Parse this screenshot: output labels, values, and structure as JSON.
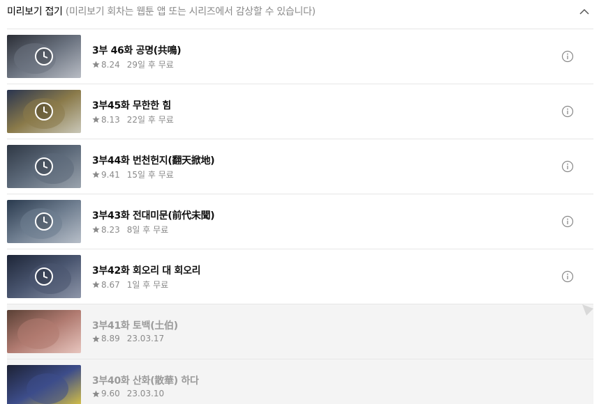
{
  "header": {
    "title": "미리보기 접기",
    "subtitle": "(미리보기 회차는 웹툰 앱 또는 시리즈에서 감상할 수 있습니다)",
    "collapse_icon": "chevron-up-icon"
  },
  "episodes": [
    {
      "title": "3부 46화 공명(共鳴)",
      "rating": "8.24",
      "status": "29일 후 무료",
      "preview": true,
      "thumb_palette": [
        "#2b2e36",
        "#6b7380",
        "#b8bcc4"
      ]
    },
    {
      "title": "3부45화 무한한 힘",
      "rating": "8.13",
      "status": "22일 후 무료",
      "preview": true,
      "thumb_palette": [
        "#2a3550",
        "#8a7a4a",
        "#c9c7b8"
      ]
    },
    {
      "title": "3부44화 번천헌지(翻天掀地)",
      "rating": "9.41",
      "status": "15일 후 무료",
      "preview": true,
      "thumb_palette": [
        "#2f3845",
        "#5d6a7a",
        "#9aa3ad"
      ]
    },
    {
      "title": "3부43화 전대미문(前代未聞)",
      "rating": "8.23",
      "status": "8일 후 무료",
      "preview": true,
      "thumb_palette": [
        "#2a3a4e",
        "#6e7d8f",
        "#b7bec8"
      ]
    },
    {
      "title": "3부42화 회오리 대 회오리",
      "rating": "8.67",
      "status": "1일 후 무료",
      "preview": true,
      "thumb_palette": [
        "#1e2638",
        "#4a5670",
        "#8d95a8"
      ]
    },
    {
      "title": "3부41화 토백(土伯)",
      "rating": "8.89",
      "status": "23.03.17",
      "preview": false,
      "thumb_palette": [
        "#5a4035",
        "#b07a70",
        "#e7c5be"
      ]
    },
    {
      "title": "3부40화 산화(散華) 하다",
      "rating": "9.60",
      "status": "23.03.10",
      "preview": false,
      "thumb_palette": [
        "#1d2235",
        "#3d4d8a",
        "#e0c840"
      ]
    }
  ],
  "colors": {
    "accent_gray": "#8a8a8a",
    "divider": "#e6e6e6",
    "free_row_bg": "#f4f4f4"
  }
}
